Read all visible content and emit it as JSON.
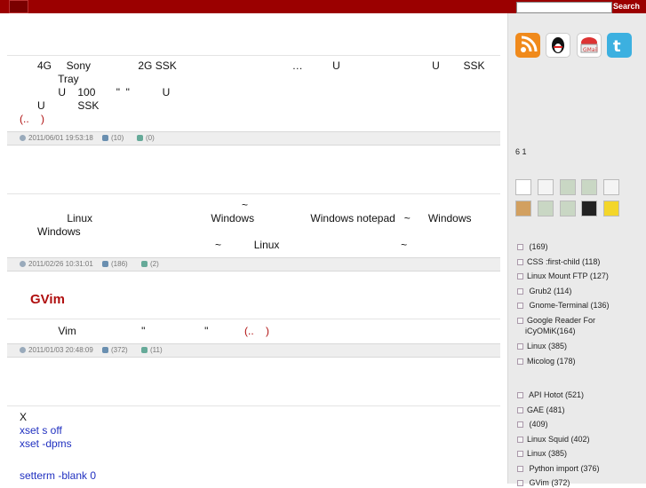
{
  "topbar": {
    "search_label": "Search",
    "search_placeholder": ""
  },
  "posts": [
    {
      "lines": [
        "      4G     Sony                2G SSK                                       …          U                               U        SSK",
        "             Tray",
        "             U    100       \"  \"           U",
        "      U           SSK"
      ],
      "more": "(..    )",
      "meta": {
        "date": "2011/06/01 19:53:18",
        "comments": "(10)",
        "trackbacks": "(0)"
      }
    },
    {
      "lines": [
        "                                                                           ~",
        "                Linux                                        Windows                   Windows notepad   ~      Windows",
        "      Windows",
        "                                                                  ~           Linux                                         ~"
      ],
      "meta": {
        "date": "2011/02/26 10:31:01",
        "comments": "(186)",
        "trackbacks": "(2)"
      }
    },
    {
      "title": "GVim",
      "lines": [
        "             Vim                      \"                    \"                           "
      ],
      "more": "(..    )",
      "meta": {
        "date": "2011/01/03 20:48:09",
        "comments": "(372)",
        "trackbacks": "(11)"
      }
    }
  ],
  "post4": {
    "x": "X",
    "line1": "xset s off",
    "line2": "xset -dpms",
    "line3": "setterm -blank 0"
  },
  "sidebar": {
    "count_text": "6 1",
    "list1": [
      {
        "label": "       (169)"
      },
      {
        "label": "CSS :first-child  (118)"
      },
      {
        "label": "Linux  Mount FTP  (127)"
      },
      {
        "label": "  Grub2        (114)"
      },
      {
        "label": "    Gnome-Terminal   (136)"
      },
      {
        "label": "Google Reader For"
      },
      {
        "label": "iCyOMiK(164)"
      },
      {
        "label": "Linux      (385)"
      },
      {
        "label": "Micolog      (178)"
      }
    ],
    "list2": [
      {
        "label": "    API  Hotot  (521)"
      },
      {
        "label": "GAE       (481)"
      },
      {
        "label": "          (409)"
      },
      {
        "label": "Linux   Squid      (402)"
      },
      {
        "label": "Linux        (385)"
      },
      {
        "label": "  Python import   (376)"
      },
      {
        "label": "  GVim         (372)"
      }
    ]
  }
}
